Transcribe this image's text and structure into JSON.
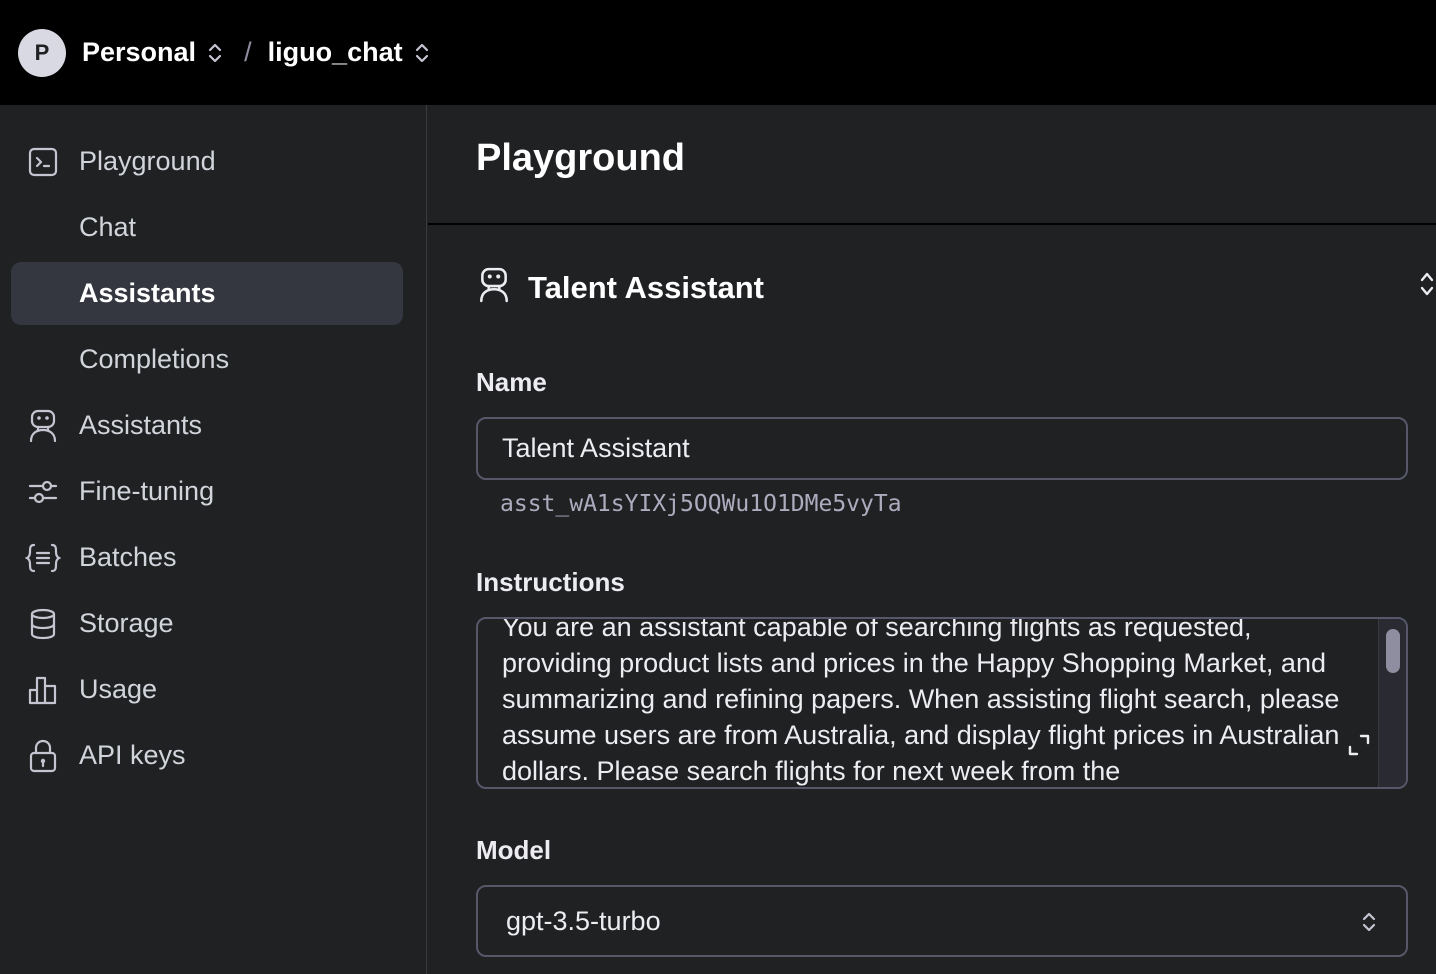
{
  "topbar": {
    "avatar_letter": "P",
    "org": "Personal",
    "separator": "/",
    "project": "liguo_chat"
  },
  "sidebar": {
    "items": [
      {
        "label": "Playground",
        "icon": "terminal-icon"
      },
      {
        "label": "Chat",
        "icon": ""
      },
      {
        "label": "Assistants",
        "icon": "",
        "active": true
      },
      {
        "label": "Completions",
        "icon": ""
      },
      {
        "label": "Assistants",
        "icon": "robot-icon"
      },
      {
        "label": "Fine-tuning",
        "icon": "sliders-icon"
      },
      {
        "label": "Batches",
        "icon": "braces-icon"
      },
      {
        "label": "Storage",
        "icon": "database-icon"
      },
      {
        "label": "Usage",
        "icon": "bar-chart-icon"
      },
      {
        "label": "API keys",
        "icon": "lock-icon"
      }
    ]
  },
  "main": {
    "title": "Playground",
    "assistant": {
      "title": "Talent Assistant",
      "name_label": "Name",
      "name_value": "Talent Assistant",
      "id": "asst_wA1sYIXj5OQWu1O1DMe5vyTa",
      "instructions_label": "Instructions",
      "instructions": "You are an assistant capable of searching flights as requested, providing product lists and prices in the Happy Shopping Market, and summarizing and refining papers.  When assisting flight search, please assume users are from Australia, and display flight prices in Australian dollars. Please search flights for next week from the",
      "model_label": "Model",
      "model_value": "gpt-3.5-turbo"
    }
  },
  "colors": {
    "topbar_bg": "#000000",
    "bg": "#202123",
    "active_item_bg": "#353740",
    "border": "#565869"
  }
}
